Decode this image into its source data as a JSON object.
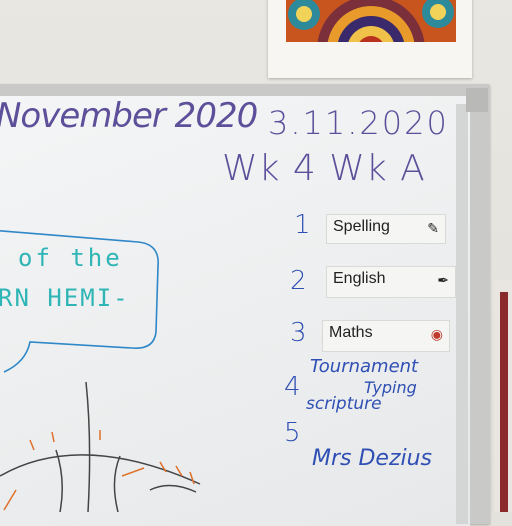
{
  "board": {
    "date_words": "November 2020",
    "date_numeric": "3.11.2020",
    "week": "Wk 4 Wk A",
    "hemisphere_line1": "of the",
    "hemisphere_line2": "RN HEMI-",
    "schedule": [
      {
        "number": "1",
        "label": "Spelling",
        "icon": "pencil-icon"
      },
      {
        "number": "2",
        "label": "English",
        "icon": "pen-icon"
      },
      {
        "number": "3",
        "label": "Maths",
        "icon": "calculator-icon"
      }
    ],
    "item4_number": "4",
    "item4_line1": "Tournament",
    "item4_line2": "Typing",
    "item4_line3": "scripture",
    "item5_number": "5",
    "item5_label": "Mrs Dezius"
  },
  "colors": {
    "marker_purple": "#5d4f9a",
    "marker_blue": "#2f4fb4",
    "marker_teal": "#2fb5b5",
    "marker_orange": "#e0702a"
  }
}
